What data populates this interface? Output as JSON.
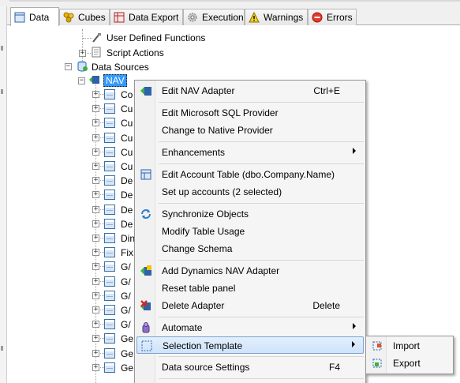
{
  "tabs": [
    {
      "label": "Data",
      "icon": "data-tab-icon",
      "active": true
    },
    {
      "label": "Cubes",
      "icon": "cubes-icon"
    },
    {
      "label": "Data Export",
      "icon": "data-export-icon"
    },
    {
      "label": "Execution",
      "icon": "gear-icon"
    },
    {
      "label": "Warnings",
      "icon": "warning-icon"
    },
    {
      "label": "Errors",
      "icon": "error-icon"
    }
  ],
  "tree": {
    "user_defined_functions": "User Defined Functions",
    "script_actions": "Script Actions",
    "data_sources": "Data Sources",
    "nav": "NAV",
    "children": [
      "Co",
      "Cu",
      "Cu",
      "Cu",
      "Cu",
      "Cu",
      "De",
      "De",
      "De",
      "De",
      "Din",
      "Fix",
      "G/",
      "G/",
      "G/",
      "G/",
      "G/",
      "Ge",
      "Ge",
      "Ge"
    ]
  },
  "context_menu": {
    "items": [
      {
        "label": "Edit NAV Adapter",
        "shortcut": "Ctrl+E",
        "icon": "adapter-icon"
      },
      {
        "label": "Edit Microsoft SQL Provider"
      },
      {
        "label": "Change to Native Provider"
      },
      {
        "label": "Enhancements",
        "submenu": true
      },
      {
        "label": "Edit Account Table (dbo.Company.Name)",
        "icon": "account-table-icon"
      },
      {
        "label": "Set up accounts (2 selected)"
      },
      {
        "label": "Synchronize Objects",
        "icon": "sync-icon"
      },
      {
        "label": "Modify Table Usage"
      },
      {
        "label": "Change Schema"
      },
      {
        "label": "Add Dynamics NAV Adapter",
        "icon": "add-adapter-icon"
      },
      {
        "label": "Reset table panel"
      },
      {
        "label": "Delete Adapter",
        "shortcut": "Delete",
        "icon": "delete-adapter-icon"
      },
      {
        "label": "Automate",
        "submenu": true,
        "icon": "automate-icon"
      },
      {
        "label": "Selection Template",
        "submenu": true,
        "highlighted": true,
        "icon": "selection-template-icon"
      },
      {
        "label": "Data source Settings",
        "shortcut": "F4"
      }
    ]
  },
  "submenu": {
    "items": [
      {
        "label": "Import",
        "icon": "import-icon"
      },
      {
        "label": "Export",
        "icon": "export-icon"
      }
    ]
  },
  "colors": {
    "selection": "#3399ff",
    "menu_highlight": "#cfe3fb",
    "menu_highlight_border": "#7da2ce",
    "table_icon": "#3a6ea5"
  }
}
